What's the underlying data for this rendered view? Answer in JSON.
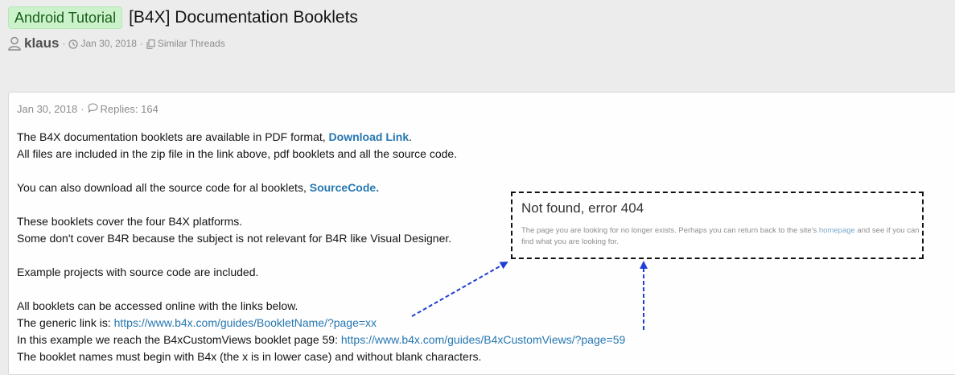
{
  "header": {
    "prefix": "Android Tutorial",
    "title": "[B4X] Documentation Booklets",
    "author": "klaus",
    "date": "Jan 30, 2018",
    "similar": "Similar Threads"
  },
  "post": {
    "date": "Jan 30, 2018",
    "replies": "Replies: 164",
    "l1_pre": "The B4X documentation booklets are available in PDF format, ",
    "l1_link": "Download Link",
    "l1_post": ".",
    "l2": "All files are included in the zip file in the link above, pdf booklets and all the source code.",
    "l3_pre": "You can also download all the source code for al booklets, ",
    "l3_link": "SourceCode.",
    "l4": "These booklets cover the four B4X platforms.",
    "l5": "Some don't cover B4R because the subject is not relevant for B4R like Visual Designer.",
    "l6": "Example projects with source code are included.",
    "l7": "All booklets can be accessed online with the links below.",
    "l8_pre": "The generic link is: ",
    "l8_link": "https://www.b4x.com/guides/BookletName/?page=xx",
    "l9_pre": "In this example we reach the B4xCustomViews booklet page 59: ",
    "l9_link": "https://www.b4x.com/guides/B4xCustomViews/?page=59",
    "l10": "The booklet names must begin with B4x (the x is in lower case) and without blank characters."
  },
  "notfound": {
    "title": "Not found, error 404",
    "text_pre": "The page you are looking for no longer exists. Perhaps you can return back to the site's ",
    "link": "homepage",
    "text_post": " and see if you can find what you are looking for."
  },
  "colors": {
    "prefix_bg": "#ccf2cc",
    "link": "#2577b1",
    "arrow": "#1f3fd6"
  }
}
